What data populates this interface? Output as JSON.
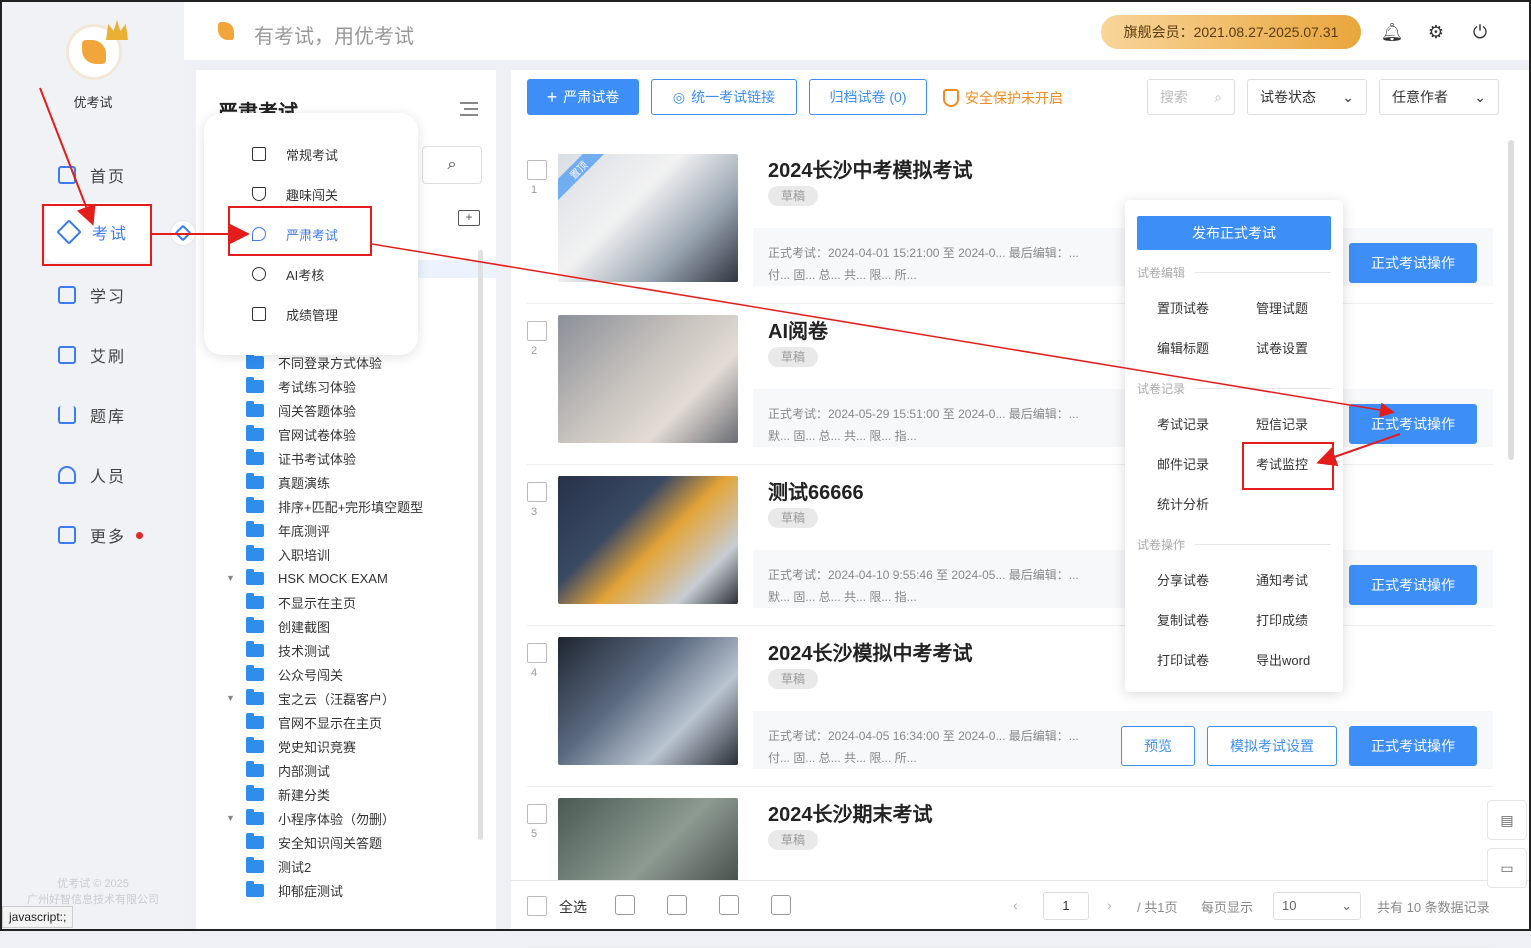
{
  "app": {
    "name": "优考试",
    "slogan": "有考试，用优考试",
    "copyright": [
      "优考试 © 2025",
      "广州好智信息技术有限公司"
    ],
    "status_url": "javascript:;"
  },
  "vip": {
    "text": "旗舰会员：2021.08.27-2025.07.31"
  },
  "nav": [
    {
      "label": "首页",
      "icon": "home-icon"
    },
    {
      "label": "考试",
      "icon": "eraser-icon",
      "active": true
    },
    {
      "label": "学习",
      "icon": "book-icon"
    },
    {
      "label": "艾刷",
      "icon": "a-badge-icon"
    },
    {
      "label": "题库",
      "icon": "bar-chart-icon"
    },
    {
      "label": "人员",
      "icon": "user-icon"
    },
    {
      "label": "更多",
      "icon": "apps-icon",
      "has_dot": true
    }
  ],
  "folder_panel": {
    "title": "严肃考试"
  },
  "submenu": [
    {
      "label": "常规考试",
      "icon": "document-icon"
    },
    {
      "label": "趣味闯关",
      "icon": "trophy-icon"
    },
    {
      "label": "严肃考试",
      "icon": "pen-nib-icon",
      "selected": true
    },
    {
      "label": "AI考核",
      "icon": "ai-icon"
    },
    {
      "label": "成绩管理",
      "icon": "report-icon"
    }
  ],
  "folders": [
    {
      "name": "不同登录方式体验",
      "expandable": false
    },
    {
      "name": "考试练习体验",
      "expandable": false
    },
    {
      "name": "闯关答题体验",
      "expandable": false
    },
    {
      "name": "官网试卷体验",
      "expandable": false
    },
    {
      "name": "证书考试体验",
      "expandable": false
    },
    {
      "name": "真题演练",
      "expandable": false
    },
    {
      "name": "排序+匹配+完形填空题型",
      "expandable": false
    },
    {
      "name": "年底测评",
      "expandable": false
    },
    {
      "name": "入职培训",
      "expandable": false
    },
    {
      "name": "HSK MOCK EXAM",
      "expandable": true
    },
    {
      "name": "不显示在主页",
      "expandable": false
    },
    {
      "name": "创建截图",
      "expandable": false
    },
    {
      "name": "技术测试",
      "expandable": false
    },
    {
      "name": "公众号闯关",
      "expandable": false
    },
    {
      "name": "宝之云（汪磊客户）",
      "expandable": true
    },
    {
      "name": "官网不显示在主页",
      "expandable": false
    },
    {
      "name": "党史知识竞赛",
      "expandable": false
    },
    {
      "name": "内部测试",
      "expandable": false
    },
    {
      "name": "新建分类",
      "expandable": false
    },
    {
      "name": "小程序体验（勿删）",
      "expandable": true
    },
    {
      "name": "安全知识闯关答题",
      "expandable": false
    },
    {
      "name": "测试2",
      "expandable": false
    },
    {
      "name": "抑郁症测试",
      "expandable": false
    }
  ],
  "toolbar": {
    "new_exam": "严肃试卷",
    "unified_link": "统一考试链接",
    "archive": "归档试卷 (0)",
    "safety": "安全保护未开启",
    "search_placeholder": "搜索",
    "status_filter": "试卷状态",
    "author_filter": "任意作者"
  },
  "exams": [
    {
      "num": "1",
      "title": "2024长沙中考模拟考试",
      "status": "草稿",
      "pinned": true,
      "pin_label": "置顶",
      "meta1": "正式考试：2024-04-01 15:21:00 至 2024-0...   最后编辑：...",
      "meta2": "付...   固...   总...   共...   限...   所..."
    },
    {
      "num": "2",
      "title": "AI阅卷",
      "status": "草稿",
      "pinned": false,
      "pin_label": "",
      "meta1": "正式考试：2024-05-29 15:51:00 至 2024-0...   最后编辑：...",
      "meta2": "默...   固...   总...   共...   限...   指..."
    },
    {
      "num": "3",
      "title": "测试66666",
      "status": "草稿",
      "pinned": false,
      "pin_label": "",
      "meta1": "正式考试：2024-04-10 9:55:46 至 2024-05...   最后编辑：...",
      "meta2": "默...   固...   总...   共...   限...   指..."
    },
    {
      "num": "4",
      "title": "2024长沙模拟中考考试",
      "status": "草稿",
      "pinned": false,
      "pin_label": "",
      "meta1": "正式考试：2024-04-05 16:34:00 至 2024-0...   最后编辑：...",
      "meta2": "付...   固...   总...   共...   限...   所..."
    },
    {
      "num": "5",
      "title": "2024长沙期末考试",
      "status": "草稿",
      "pinned": false,
      "pin_label": "",
      "meta1": "",
      "meta2": ""
    }
  ],
  "card_buttons": {
    "preview": "预览",
    "mock_settings": "模拟考试设置",
    "formal_ops": "正式考试操作"
  },
  "dropdown": {
    "publish": "发布正式考试",
    "sec_edit": "试卷编辑",
    "edit_items": [
      "置顶试卷",
      "管理试题",
      "编辑标题",
      "试卷设置"
    ],
    "sec_records": "试卷记录",
    "record_items": [
      "考试记录",
      "短信记录",
      "邮件记录",
      "考试监控",
      "统计分析"
    ],
    "sec_ops": "试卷操作",
    "op_items": [
      "分享试卷",
      "通知考试",
      "复制试卷",
      "打印成绩",
      "打印试卷",
      "导出word"
    ]
  },
  "bottom": {
    "select_all": "全选",
    "page": "1",
    "total_pages": "/ 共1页",
    "per_page_label": "每页显示",
    "per_page": "10",
    "total": "共有 10 条数据记录"
  },
  "colors": {
    "primary": "#3d8ef7",
    "annotation": "#e51c1c",
    "warning": "#f08c1e",
    "vip_gold": "#e9a63d"
  }
}
